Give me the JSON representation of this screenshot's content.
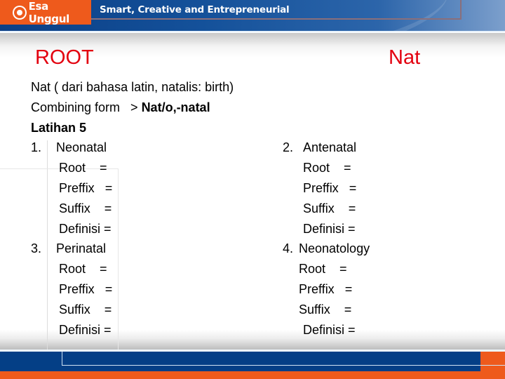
{
  "header": {
    "logo_text": "Esa Unggul",
    "tagline": "Smart, Creative and Entrepreneurial"
  },
  "titles": {
    "left": "ROOT",
    "right": "Nat"
  },
  "intro": {
    "line1": "Nat ( dari bahasa latin, natalis: birth)",
    "combining_label": "Combining form   > ",
    "combining_value": "Nat/o,-natal",
    "exercise": "Latihan 5"
  },
  "items": [
    {
      "number": "1.",
      "term": "Neonatal",
      "fields": [
        "Root    =",
        "Preffix   =",
        "Suffix    =",
        "Definisi ="
      ]
    },
    {
      "number": "2.",
      "term": "Antenatal",
      "fields": [
        "Root    =",
        "Preffix   =",
        "Suffix    =",
        "Definisi ="
      ]
    },
    {
      "number": "3.",
      "term": "Perinatal",
      "fields": [
        "Root    =",
        "Preffix   =",
        "Suffix    =",
        "Definisi ="
      ]
    },
    {
      "number": "4.",
      "term": "Neonatology",
      "fields": [
        "Root    =",
        "Preffix   =",
        "Suffix    =",
        "Definisi ="
      ]
    }
  ]
}
